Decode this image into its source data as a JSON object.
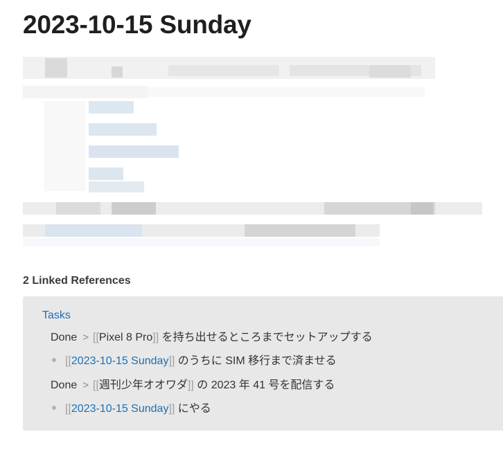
{
  "page": {
    "title": "2023-10-15 Sunday"
  },
  "linked_references": {
    "heading": "2 Linked References",
    "groups": [
      {
        "page": "Tasks",
        "items": [
          {
            "breadcrumb": "Done",
            "separator": ">",
            "ref_open": "[[",
            "ref": "Pixel 8 Pro",
            "ref_close": "]]",
            "text": " を持ち出せるところまでセットアップする"
          },
          {
            "ref_open": "[[",
            "ref": "2023-10-15 Sunday",
            "ref_close": "]]",
            "text": " のうちに SIM 移行まで済ませる"
          },
          {
            "breadcrumb": "Done",
            "separator": ">",
            "ref_open": "[[",
            "ref": "週刊少年オオワダ",
            "ref_close": "]]",
            "text": " の 2023 年 41 号を配信する"
          },
          {
            "ref_open": "[[",
            "ref": "2023-10-15 Sunday",
            "ref_close": "]]",
            "text": " にやる"
          }
        ]
      }
    ]
  },
  "colors": {
    "link": "#1d6fb0",
    "panel_bg": "#e8e8e8",
    "title": "#1f1f1f"
  }
}
